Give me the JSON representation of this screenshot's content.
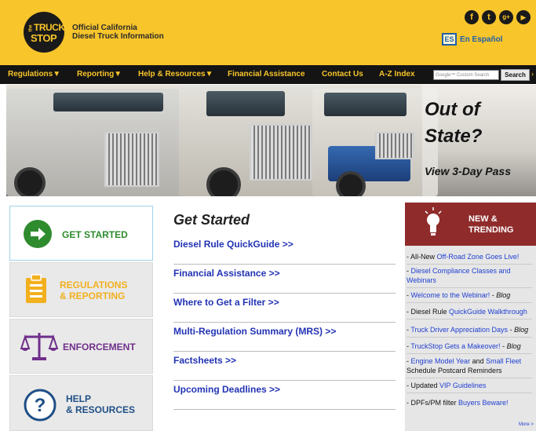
{
  "header": {
    "logo_line1": "TRUCK",
    "logo_line2": "STOP",
    "logo_the": "the",
    "tagline_line1": "Official California",
    "tagline_line2": "Diesel Truck Information",
    "social_icons": [
      "facebook-icon",
      "twitter-icon",
      "google-plus-icon",
      "youtube-icon"
    ],
    "espanol_badge": "ES",
    "espanol_label": "En Español"
  },
  "nav": {
    "items": [
      "Regulations▼",
      "Reporting▼",
      "Help & Resources▼",
      "Financial Assistance",
      "Contact Us",
      "A-Z Index"
    ],
    "search_placeholder": "Google™ Custom Search",
    "search_button": "Search",
    "more": "›"
  },
  "hero": {
    "title_line1": "Out of",
    "title_line2": "State?",
    "cta": "View 3-Day Pass"
  },
  "left_tabs": [
    {
      "label_line1": "GET STARTED",
      "label_line2": "",
      "icon": "arrow-right-icon",
      "color": "#2e8b2e"
    },
    {
      "label_line1": "REGULATIONS",
      "label_line2": "& REPORTING",
      "icon": "clipboard-icon",
      "color": "#f2b01e"
    },
    {
      "label_line1": "ENFORCEMENT",
      "label_line2": "",
      "icon": "scales-icon",
      "color": "#6f2f8a"
    },
    {
      "label_line1": "HELP",
      "label_line2": "& RESOURCES",
      "icon": "question-icon",
      "color": "#1f4f86"
    }
  ],
  "center": {
    "title": "Get Started",
    "links": [
      "Diesel Rule QuickGuide >>",
      "Financial Assistance >>",
      "Where to Get a Filter >>",
      "Multi-Regulation Summary (MRS) >>",
      "Factsheets >>",
      "Upcoming Deadlines >>"
    ]
  },
  "trending": {
    "heading_line1": "NEW &",
    "heading_line2": "TRENDING",
    "items": [
      {
        "pre": "- All-New ",
        "link": "Off-Road Zone Goes Live!",
        "post": "",
        "tag": ""
      },
      {
        "pre": "- ",
        "link": "Diesel Compliance Classes and Webinars",
        "post": "",
        "tag": ""
      },
      {
        "pre": "- ",
        "link": "Welcome to the Webinar!",
        "post": " - ",
        "tag": "Blog"
      },
      {
        "pre": "- Diesel Rule ",
        "link": "QuickGuide Walkthrough",
        "post": "",
        "tag": ""
      },
      {
        "pre": "- ",
        "link": "Truck Driver Appreciation Days",
        "post": " - ",
        "tag": "Blog"
      },
      {
        "pre": "- ",
        "link": "TruckStop Gets a Makeover!",
        "post": " - ",
        "tag": "Blog"
      },
      {
        "pre": "- ",
        "link": "Engine Model Year",
        "post": " and ",
        "link2": "Small Fleet",
        "post2": " Schedule Postcard Reminders",
        "tag": ""
      },
      {
        "pre": "- Updated ",
        "link": "VIP Guidelines",
        "post": "",
        "tag": ""
      },
      {
        "pre": "- DPFs/PM filter ",
        "link": "Buyers Beware!",
        "post": "",
        "tag": ""
      }
    ],
    "more": "More >"
  },
  "colors": {
    "header_yellow": "#f8c52b",
    "nav_black": "#141414",
    "link_blue": "#2233b4",
    "trend_red": "#8f2b2b"
  }
}
